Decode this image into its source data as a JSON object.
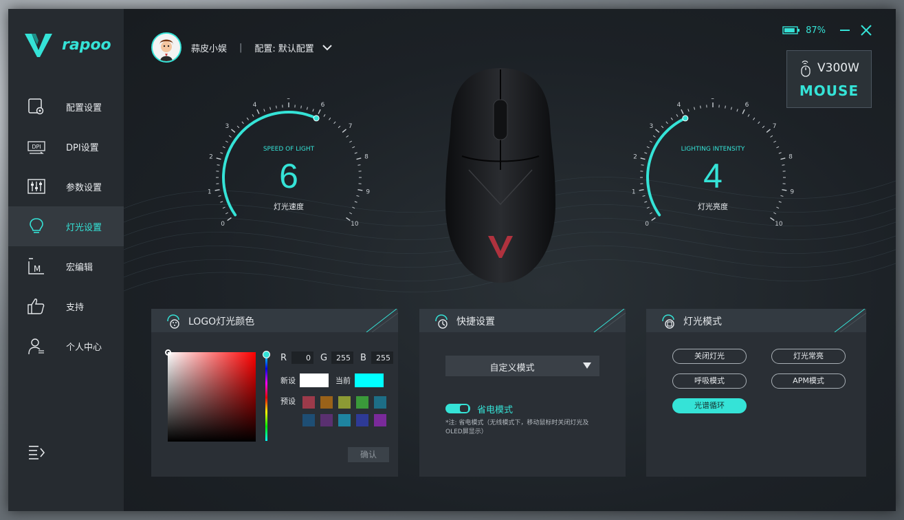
{
  "brand": {
    "name": "rapoo",
    "accent": "#35e3d7"
  },
  "nav": [
    {
      "label": "配置设置",
      "icon": "config-settings-icon"
    },
    {
      "label": "DPI设置",
      "icon": "dpi-icon"
    },
    {
      "label": "参数设置",
      "icon": "sliders-icon"
    },
    {
      "label": "灯光设置",
      "icon": "lightbulb-icon",
      "active": true
    },
    {
      "label": "宏编辑",
      "icon": "macro-icon"
    },
    {
      "label": "支持",
      "icon": "thumbs-up-icon"
    },
    {
      "label": "个人中心",
      "icon": "user-icon"
    }
  ],
  "user": {
    "name": "蒜皮小娱",
    "profile_label": "配置:",
    "profile_value": "默认配置"
  },
  "battery": {
    "percent_text": "87%",
    "level": 0.87
  },
  "device": {
    "name": "V300W",
    "type": "MOUSE"
  },
  "gauges": {
    "speed": {
      "title": "SPEED OF LIGHT",
      "value": "6",
      "label": "灯光速度",
      "level": 6
    },
    "brightness": {
      "title": "LIGHTING INTENSITY",
      "value": "4",
      "label": "灯光亮度",
      "level": 4
    },
    "ticks": [
      "0",
      "1",
      "2",
      "3",
      "4",
      "5",
      "6",
      "7",
      "8",
      "9",
      "10"
    ]
  },
  "color_panel": {
    "title": "LOGO灯光颜色",
    "r_label": "R",
    "r_value": "0",
    "g_label": "G",
    "g_value": "255",
    "b_label": "B",
    "b_value": "255",
    "new_label": "新设",
    "current_label": "当前",
    "new_color": "#ffffff",
    "current_color": "#00ffff",
    "preset_label": "预设",
    "presets": [
      "#9c3a4a",
      "#9a6219",
      "#8c9a34",
      "#3a9a3a",
      "#1d6e86",
      "#1e4e74",
      "#5a3070",
      "#1e84a0",
      "#2e3a96",
      "#7a2a9a"
    ],
    "confirm": "确认"
  },
  "quick_panel": {
    "title": "快捷设置",
    "mode_value": "自定义模式",
    "power_save_label": "省电模式",
    "note": "*注: 省电模式（无线模式下，移动鼠标时关闭灯光及OLED屏显示）"
  },
  "mode_panel": {
    "title": "灯光模式",
    "modes": [
      {
        "label": "关闭灯光",
        "active": false
      },
      {
        "label": "灯光常亮",
        "active": false
      },
      {
        "label": "呼吸模式",
        "active": false
      },
      {
        "label": "APM模式",
        "active": false
      },
      {
        "label": "光谱循环",
        "active": true
      }
    ]
  }
}
